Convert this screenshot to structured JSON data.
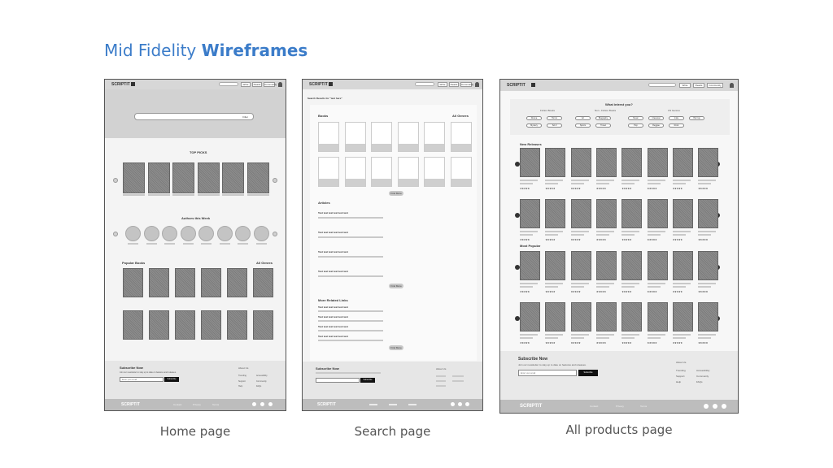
{
  "heading": {
    "light": "Mid Fidelity",
    "bold": "Wireframes"
  },
  "captions": {
    "home": "Home page",
    "search": "Search page",
    "products": "All products page"
  },
  "nav": {
    "logo": "SCRIPTIT",
    "write": "Write",
    "reads": "Reads",
    "community": "Community"
  },
  "home": {
    "search_filter": "Filter",
    "top_picks": "TOP PICKS",
    "authors": "Authors this Week",
    "popular": "Popular Books",
    "all_genres": "All Genres",
    "subscribe_title": "Subscribe Now",
    "subscribe_sub": "Join our newsletter to stay up to date on features and releases.",
    "email_placeholder": "Enter your email",
    "subscribe_btn": "Subscribe",
    "about": "About Us",
    "footer_links": [
      "Trending",
      "Support",
      "Help"
    ],
    "footer_links2": [
      "Accessibility",
      "Community",
      "FAQs"
    ],
    "bottom_links": [
      "Contact",
      "Privacy",
      "Terms"
    ]
  },
  "search": {
    "results_title": "Search Results for \"text here\"",
    "books": "Books",
    "all_genres": "All Genres",
    "find_more": "Find More",
    "articles": "Articles",
    "article_title": "Text text text text text text",
    "more_related": "More Related Links",
    "subscribe_title": "Subscribe Now",
    "subscribe_btn": "Subscribe",
    "about": "About Us"
  },
  "products": {
    "interest_title": "What intrest you?",
    "categories": [
      "Fiction Books",
      "Non - Fiction Books",
      "CS Genres"
    ],
    "genres": [
      "Drama",
      "Horror",
      "Art",
      "Biography",
      "Music",
      "Classical",
      "Indie",
      "Hip hop",
      "Mystery",
      "Sci-fi",
      "Sports",
      "Travel",
      "Pop",
      "Reggae",
      "Rock"
    ],
    "new_releases": "New Releases",
    "most_popular": "Most Popular",
    "subscribe_title": "Subscribe Now",
    "subscribe_sub": "Join our newsletter to stay up to date on features and releases.",
    "email_placeholder": "Enter your email",
    "subscribe_btn": "Subscribe",
    "about": "About Us",
    "footer_links": [
      "Trending",
      "Support",
      "Help"
    ],
    "footer_links2": [
      "Accessibility",
      "Community",
      "FAQs"
    ],
    "bottom_links": [
      "Contact",
      "Privacy",
      "Terms"
    ]
  }
}
